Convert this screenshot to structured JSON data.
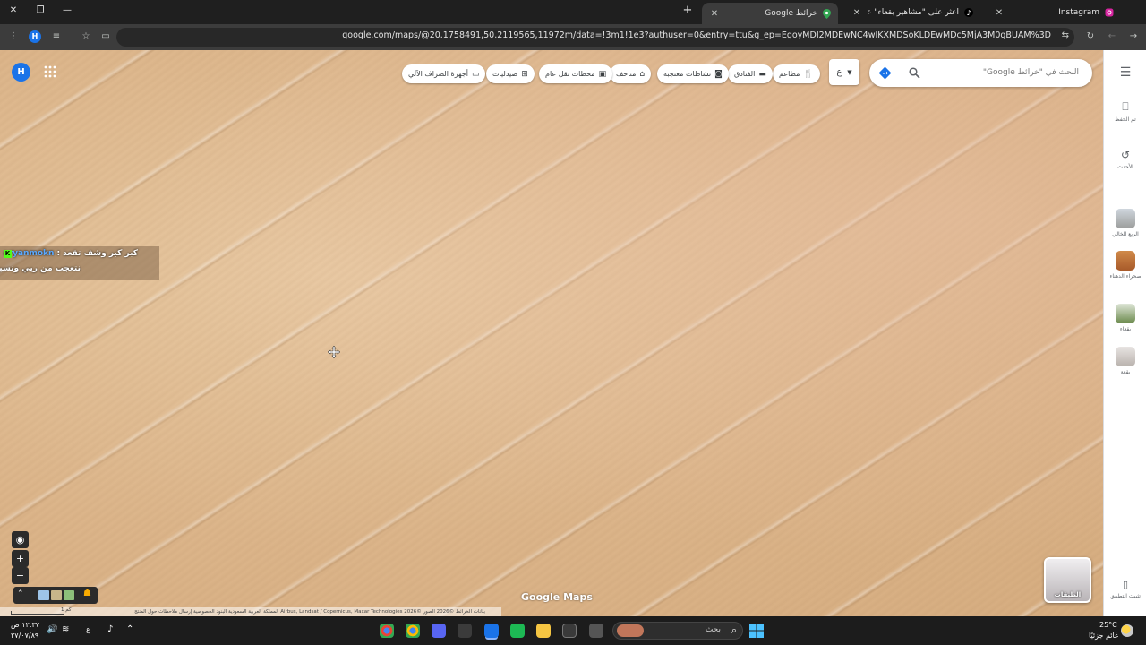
{
  "tabs": [
    {
      "title": "Instagram",
      "icon": "instagram-icon",
      "active": false
    },
    {
      "title": "اعثر على \"مشاهير بقعاء\" على Tok",
      "icon": "tiktok-icon",
      "active": false
    },
    {
      "title": "خرائط Google",
      "icon": "maps-pin-icon",
      "active": true
    }
  ],
  "tab_new": "+",
  "tab_close": "✕",
  "address": {
    "url": "google.com/maps/@20.1758491,50.2119565,11972m/data=!3m1!1e3?authuser=0&entry=ttu&g_ep=EgoyMDI2MDEwNC4wIKXMDSoKLDEwMDc5MjA3M0gBUAM%3D"
  },
  "toolbar": {
    "profile_initial": "H"
  },
  "maps": {
    "account_initial": "H",
    "search_placeholder": "البحث في \"خرائط Google\"",
    "lang_label": "ع",
    "chips": [
      {
        "label": "مطاعم",
        "icon": "utensils-icon"
      },
      {
        "label": "الفنادق",
        "icon": "bed-icon"
      },
      {
        "label": "نشاطات معتجبة",
        "icon": "camera-icon"
      },
      {
        "label": "متاحف",
        "icon": "museum-icon"
      },
      {
        "label": "محطات نقل عام",
        "icon": "transit-icon"
      },
      {
        "label": "صيدليات",
        "icon": "pharmacy-icon"
      },
      {
        "label": "أجهزة الصراف الآلي",
        "icon": "atm-icon"
      }
    ],
    "rail": [
      {
        "label": "تم الحفظ",
        "icon": "bookmark-icon"
      },
      {
        "label": "الأحدث",
        "icon": "history-icon"
      },
      {
        "label": "الربع الخالي",
        "icon": "place-thumb"
      },
      {
        "label": "صحراء الدهناء",
        "icon": "place-thumb"
      },
      {
        "label": "بقعاء",
        "icon": "place-thumb"
      },
      {
        "label": "بقعة",
        "icon": "place-thumb"
      },
      {
        "label": "تثبيت التطبيق",
        "icon": "phone-icon"
      }
    ],
    "layers_label": "الطبقات",
    "logo": "Google Maps",
    "credits": "بيانات الخرائط ©2026 الصور ©2026 Airbus, Landsat / Copernicus, Maxar Technologies   المملكة العربية السعودية   البنود   الخصوصية   إرسال ملاحظات حول المنتج",
    "scale": "1 كم"
  },
  "chat": {
    "line1_user": "aryanmokn",
    "line1_text": "كبر كبر وشف تقعد :",
    "line2_text": "نتعجب من ربي ونسبح"
  },
  "taskbar": {
    "search_label": "بحث",
    "weather_temp": "25°C",
    "weather_desc": "غائم جزئيًا",
    "time": "١٢:٣٧ ص",
    "date": "٢٧/٠٧/٨٩",
    "lang": "ع"
  },
  "colors": {
    "accent": "#1a73e8",
    "sand": "#dcb58a"
  }
}
